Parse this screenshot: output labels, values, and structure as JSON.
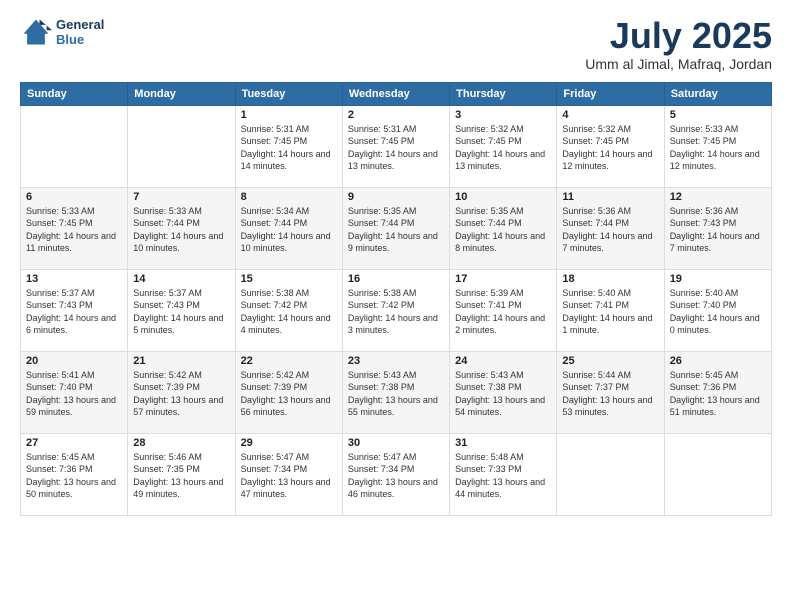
{
  "header": {
    "logo_line1": "General",
    "logo_line2": "Blue",
    "month": "July 2025",
    "location": "Umm al Jimal, Mafraq, Jordan"
  },
  "weekdays": [
    "Sunday",
    "Monday",
    "Tuesday",
    "Wednesday",
    "Thursday",
    "Friday",
    "Saturday"
  ],
  "weeks": [
    [
      {
        "day": "",
        "info": ""
      },
      {
        "day": "",
        "info": ""
      },
      {
        "day": "1",
        "info": "Sunrise: 5:31 AM\nSunset: 7:45 PM\nDaylight: 14 hours and 14 minutes."
      },
      {
        "day": "2",
        "info": "Sunrise: 5:31 AM\nSunset: 7:45 PM\nDaylight: 14 hours and 13 minutes."
      },
      {
        "day": "3",
        "info": "Sunrise: 5:32 AM\nSunset: 7:45 PM\nDaylight: 14 hours and 13 minutes."
      },
      {
        "day": "4",
        "info": "Sunrise: 5:32 AM\nSunset: 7:45 PM\nDaylight: 14 hours and 12 minutes."
      },
      {
        "day": "5",
        "info": "Sunrise: 5:33 AM\nSunset: 7:45 PM\nDaylight: 14 hours and 12 minutes."
      }
    ],
    [
      {
        "day": "6",
        "info": "Sunrise: 5:33 AM\nSunset: 7:45 PM\nDaylight: 14 hours and 11 minutes."
      },
      {
        "day": "7",
        "info": "Sunrise: 5:33 AM\nSunset: 7:44 PM\nDaylight: 14 hours and 10 minutes."
      },
      {
        "day": "8",
        "info": "Sunrise: 5:34 AM\nSunset: 7:44 PM\nDaylight: 14 hours and 10 minutes."
      },
      {
        "day": "9",
        "info": "Sunrise: 5:35 AM\nSunset: 7:44 PM\nDaylight: 14 hours and 9 minutes."
      },
      {
        "day": "10",
        "info": "Sunrise: 5:35 AM\nSunset: 7:44 PM\nDaylight: 14 hours and 8 minutes."
      },
      {
        "day": "11",
        "info": "Sunrise: 5:36 AM\nSunset: 7:44 PM\nDaylight: 14 hours and 7 minutes."
      },
      {
        "day": "12",
        "info": "Sunrise: 5:36 AM\nSunset: 7:43 PM\nDaylight: 14 hours and 7 minutes."
      }
    ],
    [
      {
        "day": "13",
        "info": "Sunrise: 5:37 AM\nSunset: 7:43 PM\nDaylight: 14 hours and 6 minutes."
      },
      {
        "day": "14",
        "info": "Sunrise: 5:37 AM\nSunset: 7:43 PM\nDaylight: 14 hours and 5 minutes."
      },
      {
        "day": "15",
        "info": "Sunrise: 5:38 AM\nSunset: 7:42 PM\nDaylight: 14 hours and 4 minutes."
      },
      {
        "day": "16",
        "info": "Sunrise: 5:38 AM\nSunset: 7:42 PM\nDaylight: 14 hours and 3 minutes."
      },
      {
        "day": "17",
        "info": "Sunrise: 5:39 AM\nSunset: 7:41 PM\nDaylight: 14 hours and 2 minutes."
      },
      {
        "day": "18",
        "info": "Sunrise: 5:40 AM\nSunset: 7:41 PM\nDaylight: 14 hours and 1 minute."
      },
      {
        "day": "19",
        "info": "Sunrise: 5:40 AM\nSunset: 7:40 PM\nDaylight: 14 hours and 0 minutes."
      }
    ],
    [
      {
        "day": "20",
        "info": "Sunrise: 5:41 AM\nSunset: 7:40 PM\nDaylight: 13 hours and 59 minutes."
      },
      {
        "day": "21",
        "info": "Sunrise: 5:42 AM\nSunset: 7:39 PM\nDaylight: 13 hours and 57 minutes."
      },
      {
        "day": "22",
        "info": "Sunrise: 5:42 AM\nSunset: 7:39 PM\nDaylight: 13 hours and 56 minutes."
      },
      {
        "day": "23",
        "info": "Sunrise: 5:43 AM\nSunset: 7:38 PM\nDaylight: 13 hours and 55 minutes."
      },
      {
        "day": "24",
        "info": "Sunrise: 5:43 AM\nSunset: 7:38 PM\nDaylight: 13 hours and 54 minutes."
      },
      {
        "day": "25",
        "info": "Sunrise: 5:44 AM\nSunset: 7:37 PM\nDaylight: 13 hours and 53 minutes."
      },
      {
        "day": "26",
        "info": "Sunrise: 5:45 AM\nSunset: 7:36 PM\nDaylight: 13 hours and 51 minutes."
      }
    ],
    [
      {
        "day": "27",
        "info": "Sunrise: 5:45 AM\nSunset: 7:36 PM\nDaylight: 13 hours and 50 minutes."
      },
      {
        "day": "28",
        "info": "Sunrise: 5:46 AM\nSunset: 7:35 PM\nDaylight: 13 hours and 49 minutes."
      },
      {
        "day": "29",
        "info": "Sunrise: 5:47 AM\nSunset: 7:34 PM\nDaylight: 13 hours and 47 minutes."
      },
      {
        "day": "30",
        "info": "Sunrise: 5:47 AM\nSunset: 7:34 PM\nDaylight: 13 hours and 46 minutes."
      },
      {
        "day": "31",
        "info": "Sunrise: 5:48 AM\nSunset: 7:33 PM\nDaylight: 13 hours and 44 minutes."
      },
      {
        "day": "",
        "info": ""
      },
      {
        "day": "",
        "info": ""
      }
    ]
  ]
}
